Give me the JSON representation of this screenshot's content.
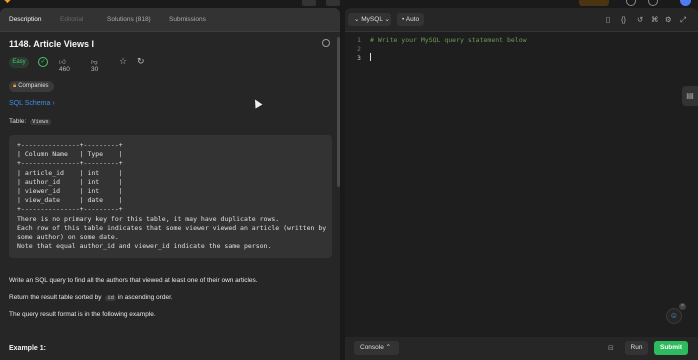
{
  "tabs": {
    "description": "Description",
    "editorial": "Editorial",
    "solutions": "Solutions (818)",
    "submissions": "Submissions"
  },
  "problem": {
    "title": "1148. Article Views I",
    "difficulty": "Easy",
    "likes": "460",
    "dislikes": "30",
    "companies_label": "Companies",
    "schema_link": "SQL Schema",
    "table_prefix": "Table:",
    "table_name": "Views",
    "schema_text": "+---------------+---------+\n| Column Name   | Type    |\n+---------------+---------+\n| article_id    | int     |\n| author_id     | int     |\n| viewer_id     | int     |\n| view_date     | date    |\n+---------------+---------+\nThere is no primary key for this table, it may have duplicate rows.\nEach row of this table indicates that some viewer viewed an article (written by\nsome author) on some date.\nNote that equal author_id and viewer_id indicate the same person.",
    "p1": "Write an SQL query to find all the authors that viewed at least one of their own articles.",
    "p2_before": "Return the result table sorted by",
    "p2_code": "id",
    "p2_after": "in ascending order.",
    "p3": "The query result format is in the following example.",
    "example_heading": "Example 1:"
  },
  "editor": {
    "language": "MySQL",
    "mode": "Auto",
    "line_numbers": [
      "1",
      "2",
      "3"
    ],
    "code_line1": "# Write your MySQL query statement below"
  },
  "footer": {
    "console": "Console",
    "run": "Run",
    "submit": "Submit"
  },
  "colors": {
    "accent_green": "#2cbb5d",
    "link_blue": "#3e8fe8",
    "easy_green": "#46c26a"
  }
}
